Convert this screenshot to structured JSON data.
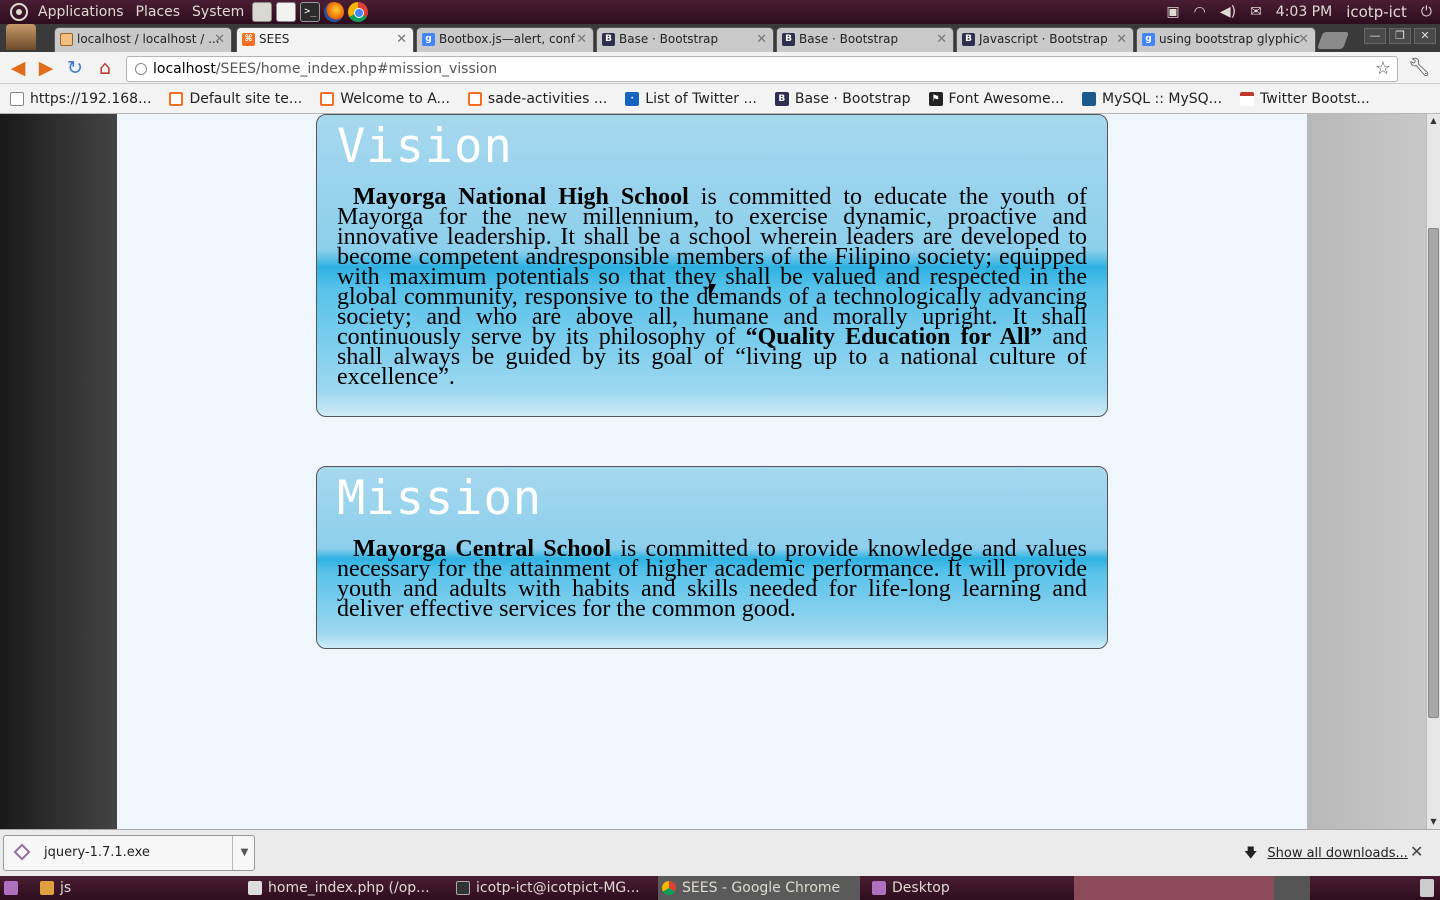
{
  "top_panel": {
    "menus": [
      "Applications",
      "Places",
      "System"
    ],
    "clock": "4:03 PM",
    "user": "icotp-ict"
  },
  "tabs": [
    {
      "title": "localhost / localhost / ...",
      "favicon": "phpmyadmin-icon"
    },
    {
      "title": "SEES",
      "favicon": "xampp-icon"
    },
    {
      "title": "Bootbox.js—alert, conf",
      "favicon": "google-icon"
    },
    {
      "title": "Base · Bootstrap",
      "favicon": "bootstrap-icon"
    },
    {
      "title": "Base · Bootstrap",
      "favicon": "bootstrap-icon"
    },
    {
      "title": "Javascript · Bootstrap",
      "favicon": "bootstrap-icon"
    },
    {
      "title": "using bootstrap glyphic",
      "favicon": "google-icon"
    }
  ],
  "address_bar": {
    "host": "localhost",
    "path": "/SEES/home_index.php#mission_vission"
  },
  "bookmarks": [
    "https://192.168...",
    "Default site te...",
    "Welcome to A...",
    "sade-activities ...",
    "List of Twitter ...",
    "Base · Bootstrap",
    "Font Awesome...",
    "MySQL :: MySQ...",
    "Twitter Bootst..."
  ],
  "vision": {
    "title": "Vision",
    "school": "Mayorga National High School",
    "text_1": " is committed to educate the youth of Mayorga for the new millennium, to exercise dynamic, proactive and innovative leadership. It shall be a school wherein leaders are developed to become competent andresponsible members of the Filipino society; equipped with maximum potentials so that they shall be valued and respected in the global community, responsive to the demands of a technologically advancing society; and who are above all, humane and morally upright. It shall continuously serve by its philosophy of ",
    "philosophy": "“Quality Education for All”",
    "text_2": " and shall always be guided by its goal of “living up to a national culture of excellence”."
  },
  "mission": {
    "title": "Mission",
    "school": "Mayorga Central School",
    "text": " is committed to provide knowledge and values necessary for the attainment of higher academic performance. It will provide youth and adults with habits and skills needed for life-long learning and deliver effective services for the common good."
  },
  "download_shelf": {
    "file": "jquery-1.7.1.exe",
    "show_all": "Show all downloads..."
  },
  "taskbar": {
    "folder": "js",
    "tasks": [
      "home_index.php (/op...",
      "icotp-ict@icotpict-MG...",
      "SEES - Google Chrome",
      "Desktop"
    ]
  }
}
